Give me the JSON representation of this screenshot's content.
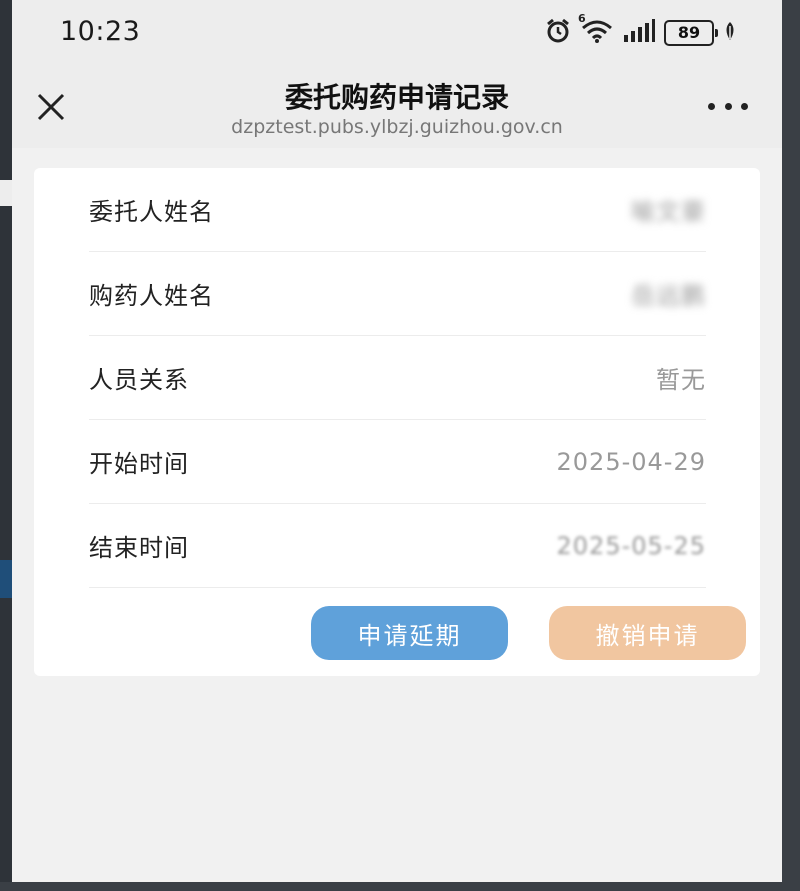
{
  "status_bar": {
    "time": "10:23",
    "network_label": "6",
    "battery": "89",
    "icons": [
      "alarm-icon",
      "wifi-icon",
      "signal-icon",
      "battery-icon",
      "leaf-icon"
    ]
  },
  "header": {
    "title": "委托购药申请记录",
    "url": "dzpztest.pubs.ylbzj.guizhou.gov.cn",
    "close_icon": "close-icon",
    "more_icon": "more-icon"
  },
  "record": {
    "rows": [
      {
        "label": "委托人姓名",
        "value": "喻文豪"
      },
      {
        "label": "购药人姓名",
        "value": "岳远鹏"
      },
      {
        "label": "人员关系",
        "value": "暂无"
      },
      {
        "label": "开始时间",
        "value": "2025-04-29"
      },
      {
        "label": "结束时间",
        "value": "2025-05-25"
      }
    ]
  },
  "actions": {
    "extend_label": "申请延期",
    "cancel_label": "撤销申请"
  },
  "colors": {
    "extend_button": "#5fa1da",
    "cancel_button": "#f1c6a0",
    "page_background": "#f1f1f1",
    "card_background": "#ffffff"
  }
}
